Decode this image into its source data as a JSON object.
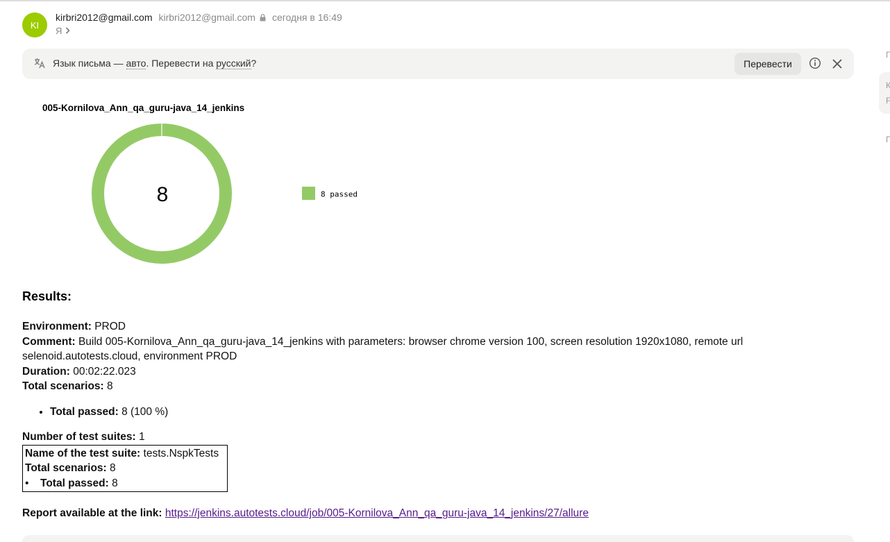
{
  "header": {
    "avatar_initials": "KI",
    "sender_name": "kirbri2012@gmail.com",
    "sender_email": "kirbri2012@gmail.com",
    "sent_time": "сегодня в 16:49",
    "recipient": "Я"
  },
  "translate_bar": {
    "text_prefix": "Язык письма — ",
    "language_link": "авто",
    "text_middle": ". Перевести на ",
    "target_link": "русский",
    "text_suffix": "?",
    "translate_button": "Перевести"
  },
  "chart": {
    "title": "005-Kornilova_Ann_qa_guru-java_14_jenkins",
    "center_value": "8",
    "legend_label": "8 passed"
  },
  "chart_data": {
    "type": "pie",
    "title": "005-Kornilova_Ann_qa_guru-java_14_jenkins",
    "categories": [
      "passed"
    ],
    "values": [
      8
    ],
    "colors": [
      "#94ca66"
    ],
    "legend_position": "right"
  },
  "results": {
    "heading": "Results:",
    "environment_label": "Environment:",
    "environment_value": " PROD",
    "comment_label": "Comment:",
    "comment_value": " Build 005-Kornilova_Ann_qa_guru-java_14_jenkins with parameters: browser chrome version 100, screen resolution 1920x1080, remote url selenoid.autotests.cloud, environment PROD",
    "duration_label": "Duration:",
    "duration_value": " 00:02:22.023",
    "total_scenarios_label": "Total scenarios:",
    "total_scenarios_value": " 8",
    "total_passed_label": "Total passed:",
    "total_passed_value": " 8 (100 %)",
    "suites_label": "Number of test suites:",
    "suites_value": " 1",
    "suite": {
      "name_label": "Name of the test suite:",
      "name_value": " tests.NspkTests",
      "scenarios_label": "Total scenarios:",
      "scenarios_value": " 8",
      "passed_label": "Total passed:",
      "passed_value": " 8"
    },
    "report_label": "Report available at the link:",
    "report_url": "https://jenkins.autotests.cloud/job/005-Kornilova_Ann_qa_guru-java_14_jenkins/27/allure"
  },
  "side_fragments": [
    "П",
    "К",
    "F",
    "П"
  ],
  "colors": {
    "avatar": "#9bcb00",
    "passed": "#94ca66",
    "link": "#551a8b"
  }
}
